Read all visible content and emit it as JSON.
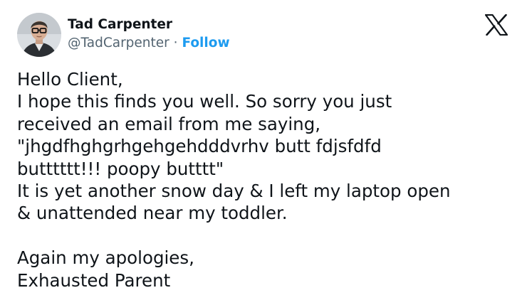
{
  "author": {
    "display_name": "Tad Carpenter",
    "handle": "@TadCarpenter",
    "separator": "·",
    "follow_label": "Follow"
  },
  "platform": {
    "logo_icon": "x-logo-icon"
  },
  "colors": {
    "text": "#0f1419",
    "secondary": "#536471",
    "accent": "#1d9bf0"
  },
  "tweet": {
    "lines": [
      "Hello Client,",
      "I hope this finds you well. So sorry you just",
      "received an email from me saying,",
      "\"jhgdfhghgrhgehgehdddvrhv butt fdjsfdfd",
      "butttttt!!! poopy butttt\"",
      "It is yet another snow day & I left my laptop open",
      "& unattended near my toddler.",
      "",
      "Again my apologies,",
      "Exhausted Parent"
    ]
  }
}
